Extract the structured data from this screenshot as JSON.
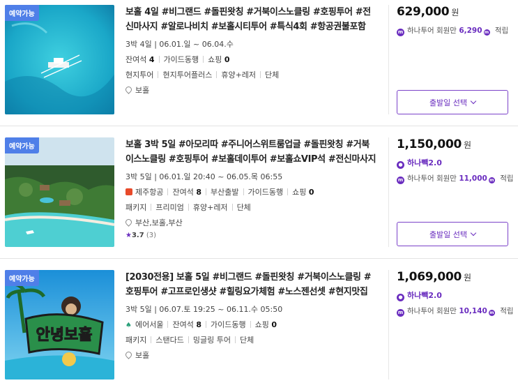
{
  "products": [
    {
      "badge": "예약가능",
      "title": "보홀 4일 #비그랜드 #돌핀왓칭 #거북이스노클링 #호핑투어 #전신마사지 #알로나비치 #보홀시티투어 #특식4회 #항공권불포함",
      "schedule": "3박 4일 | 06.01.일 ~ 06.04.수",
      "seats_label": "잔여석",
      "seats": "4",
      "guide": "가이드동행",
      "shopping_label": "쇼핑",
      "shopping": "0",
      "tags": [
        "현지투어",
        "현지투어플러스",
        "휴양+레저",
        "단체"
      ],
      "location": "보홀",
      "price": "629,000",
      "currency": "원",
      "member_text": "하나투어 회원만",
      "member_points": "6,290",
      "member_suffix": "적립",
      "button": "출발일 선택"
    },
    {
      "badge": "예약가능",
      "title": "보홀 3박 5일 #아모리따 #주니어스위트룸업글 #돌핀왓칭 #거북이스노클링 #호핑투어 #보홀데이투어 #보홀쇼VIP석 #전신마사지 #특...",
      "schedule": "3박 5일 | 06.01.일 20:40 ~ 06.05.목 06:55",
      "airline": "제주항공",
      "seats_label": "잔여석",
      "seats": "8",
      "departure": "부산출발",
      "guide": "가이드동행",
      "shopping_label": "쇼핑",
      "shopping": "0",
      "tags": [
        "패키지",
        "프리미엄",
        "휴양+레저",
        "단체"
      ],
      "location": "부산,보홀,부산",
      "rating": "3.7",
      "rating_count": "(3)",
      "price": "1,150,000",
      "currency": "원",
      "hanaback": "하나빽2.0",
      "member_text": "하나투어 회원만",
      "member_points": "11,000",
      "member_suffix": "적립",
      "button": "출발일 선택"
    },
    {
      "badge": "예약가능",
      "title": "[2030전용] 보홀 5일 #비그랜드 #돌핀왓칭 #거북이스노클링 #호핑투어 #고프로인생샷 #힐링요가체험 #노스젠선셋 #현지맛집",
      "schedule": "3박 5일 | 06.07.토 19:25 ~ 06.11.수 05:50",
      "airline": "에어서울",
      "seats_label": "잔여석",
      "seats": "8",
      "guide": "가이드동행",
      "shopping_label": "쇼핑",
      "shopping": "0",
      "tags": [
        "패키지",
        "스탠다드",
        "밍글링 투어",
        "단체"
      ],
      "location": "보홀",
      "price": "1,069,000",
      "currency": "원",
      "hanaback": "하나빽2.0",
      "member_text": "하나투어 회원만",
      "member_points": "10,140",
      "member_suffix": "적립",
      "sign_text": "안녕보홀"
    }
  ],
  "colors": {
    "accent": "#6a2dbf",
    "badge": "#4f7fe8"
  },
  "icons": {
    "location": "pin-icon",
    "point": "point-icon",
    "star": "star-icon"
  }
}
